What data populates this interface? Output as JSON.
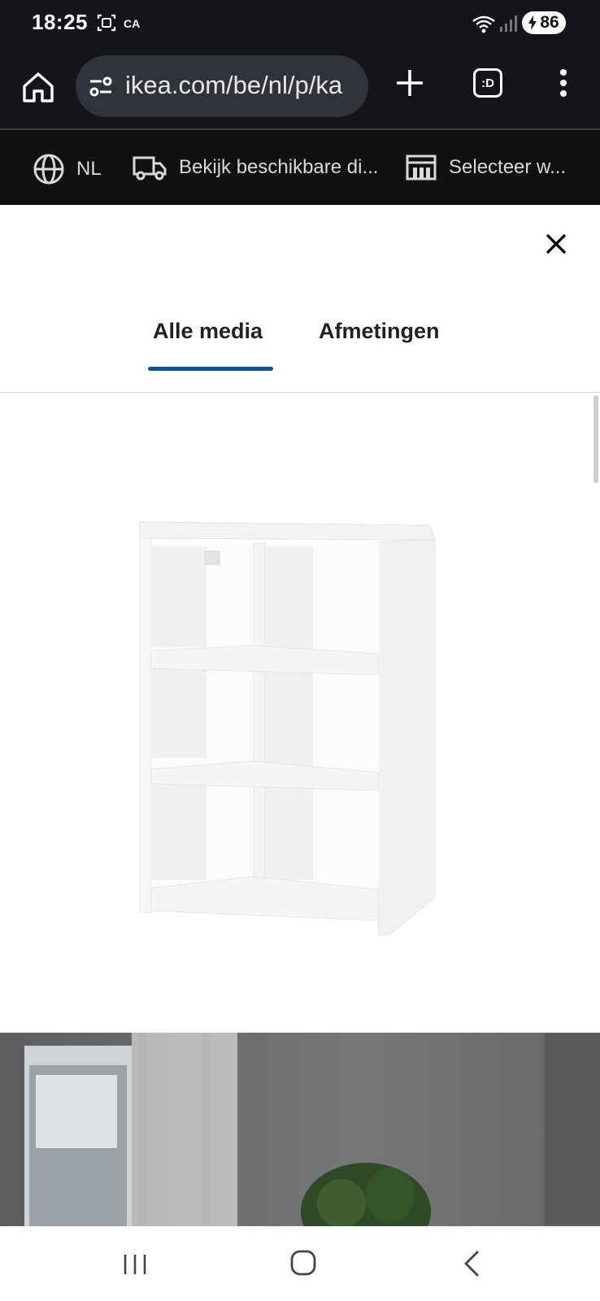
{
  "status_bar": {
    "time": "18:25",
    "carrier_badge": "CA",
    "battery": "86"
  },
  "browser": {
    "url": "ikea.com/be/nl/p/ka",
    "tabs_label": ":D"
  },
  "ikea_strip": {
    "language": "NL",
    "delivery": "Bekijk beschikbare di...",
    "store": "Selecteer w..."
  },
  "modal": {
    "tabs": [
      {
        "label": "Alle media",
        "active": true
      },
      {
        "label": "Afmetingen",
        "active": false
      }
    ]
  },
  "colors": {
    "accent": "#0058a3",
    "header_bg": "#13151b",
    "strip_bg": "#111111"
  },
  "icons": [
    "screenshot-icon",
    "wifi-icon",
    "signal-icon",
    "battery-icon",
    "home-icon",
    "site-settings-icon",
    "plus-icon",
    "tabs-icon",
    "more-vert-icon",
    "globe-icon",
    "truck-icon",
    "store-icon",
    "close-icon",
    "recent-apps-icon",
    "nav-home-icon",
    "nav-back-icon"
  ]
}
